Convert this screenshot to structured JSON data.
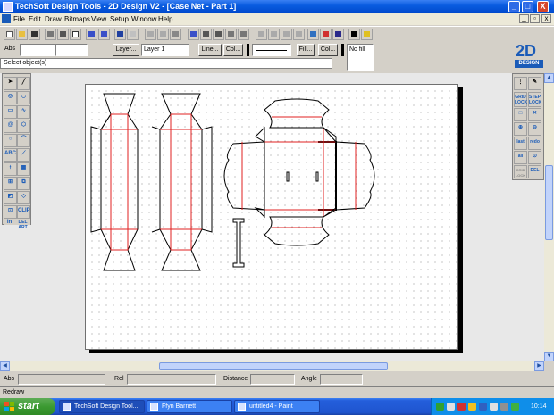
{
  "window": {
    "title": "TechSoft Design Tools - 2D Design V2 - [Case Net - Part 1]",
    "app_icon": "2d-design-app-icon",
    "controls": {
      "minimize": "_",
      "maximize": "□",
      "close": "X"
    }
  },
  "menu": {
    "items": [
      "File",
      "Edit",
      "Draw",
      "Bitmaps",
      "View",
      "Setup",
      "Window",
      "Help"
    ],
    "mdi_controls": {
      "minimize": "_",
      "restore": "▫",
      "close": "x"
    }
  },
  "toolbar": {
    "icons": [
      "new-icon",
      "open-icon",
      "save-icon",
      "print-icon",
      "cut-icon",
      "copy-icon",
      "paste-icon",
      "undo-icon",
      "redo-icon",
      "text-icon",
      "zoom-icon",
      "grid-icon",
      "snap-icon",
      "help-icon",
      "whats-this-icon"
    ]
  },
  "properties": {
    "abs_label": "Abs",
    "layer_button": "Layer...",
    "layer_value": "Layer 1",
    "line_button": "Line...",
    "col_button": "Col...",
    "fill_button": "Fill...",
    "col2_button": "Col...",
    "fill_value": "No fill",
    "status_prompt": "Select object(s)"
  },
  "logo": {
    "big": "2D",
    "small": "DESIGN"
  },
  "left_toolbox": {
    "labels": {
      "abc": "ABC",
      "clip": "CLIP",
      "del_art": "DEL\nART",
      "in": "in"
    }
  },
  "right_toolbox": {
    "labels": {
      "grid_lock": "GRID\nLOCK",
      "step_lock": "STEP\nLOCK",
      "last": "last",
      "redo": "redo",
      "all": "all",
      "del": "DEL",
      "grid_lock2": "GRID\nLOCK",
      "del_last": "DEL\nLAST"
    }
  },
  "coordinates": {
    "abs_label": "Abs",
    "rel_label": "Rel",
    "distance_label": "Distance",
    "angle_label": "Angle"
  },
  "status": {
    "text": "Redraw"
  },
  "taskbar": {
    "start": "start",
    "tasks": [
      {
        "label": "TechSoft Design Tool...",
        "active": true
      },
      {
        "label": "Ffyn Barnett",
        "active": false
      },
      {
        "label": "untitled4 - Paint",
        "active": false
      }
    ],
    "clock": "10:14"
  },
  "colors": {
    "outline": "#000000",
    "fold_line": "#e02020",
    "titlebar": "#0a5ce0",
    "brand": "#1a5bb8"
  }
}
